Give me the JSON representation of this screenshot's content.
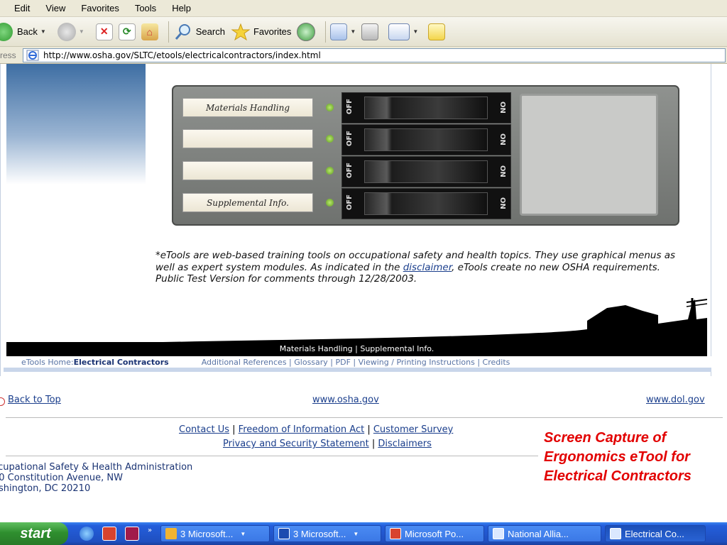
{
  "menu": [
    "Edit",
    "View",
    "Favorites",
    "Tools",
    "Help"
  ],
  "toolbar": {
    "back": "Back",
    "search": "Search",
    "favorites": "Favorites"
  },
  "address": {
    "label": "ress",
    "url": "http://www.osha.gov/SLTC/etools/electricalcontractors/index.html"
  },
  "breaker_panel": {
    "labels": [
      "Materials Handling",
      "",
      "",
      "Supplemental Info."
    ],
    "off": "OFF",
    "on": "ON"
  },
  "intro": {
    "part1": "*eTools are web-based training tools on occupational safety and health topics. They use graphical menus as well as expert system modules. As indicated in the ",
    "link": "disclaimer",
    "part2": ", eTools create no new OSHA requirements. Public Test Version for comments through 12/28/2003."
  },
  "black_nav": "Materials Handling | Supplemental Info.",
  "etools_nav": {
    "home": "eTools Home",
    "sep": " : ",
    "current": "Electrical Contractors",
    "links": "Additional References | Glossary | PDF | Viewing / Printing Instructions | Credits"
  },
  "footer": {
    "back_to_top": "Back to Top",
    "osha": "www.osha.gov",
    "dol": "www.dol.gov",
    "contact": "Contact Us",
    "foia": "Freedom of Information Act",
    "survey": "Customer Survey",
    "privacy": "Privacy and Security Statement",
    "disclaimers": "Disclaimers",
    "sep": " | ",
    "address_lines": [
      "ccupational Safety & Health Administration",
      "00 Constitution Avenue, NW",
      "ashington, DC 20210"
    ]
  },
  "caption": "Screen Capture of Ergonomics eTool for Electrical Contractors",
  "taskbar": {
    "start": "start",
    "more": "»",
    "tasks": [
      "3 Microsoft...",
      "3 Microsoft...",
      "Microsoft Po...",
      "National Allia...",
      "Electrical Co..."
    ]
  },
  "colors": {
    "caption": "#e20000",
    "link": "#1a3e8c",
    "taskbar": "#245edb",
    "start": "#2f8f2f"
  }
}
